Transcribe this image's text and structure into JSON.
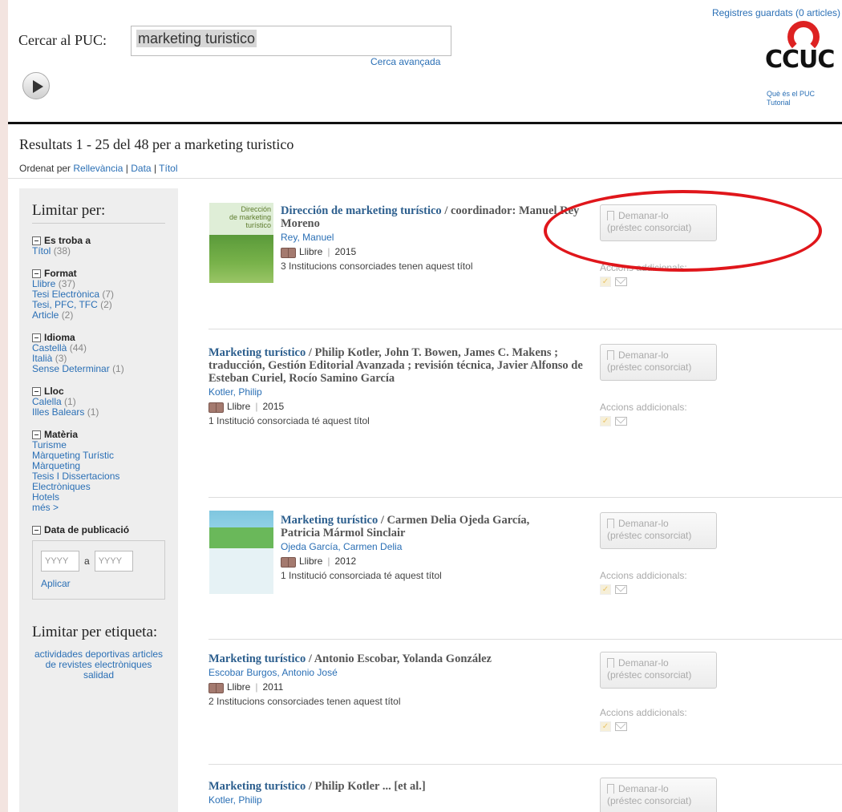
{
  "header": {
    "saved_records": "Registres guardats (0 articles)",
    "search_label": "Cercar al PUC:",
    "search_value": "marketing turistico",
    "advanced_search": "Cerca avançada",
    "logo_text": "CCUC",
    "logo_link_1": "Què és el PUC",
    "logo_link_2": "Tutorial"
  },
  "results": {
    "summary": "Resultats 1 - 25 del 48 per a marketing turistico",
    "sort_label": "Ordenat per",
    "sort_options": [
      "Rellevància",
      "Data",
      "Títol"
    ]
  },
  "sidebar": {
    "title": "Limitar per:",
    "facets": [
      {
        "name": "Es troba a",
        "items": [
          {
            "label": "Títol",
            "count": "(38)"
          }
        ]
      },
      {
        "name": "Format",
        "items": [
          {
            "label": "Llibre",
            "count": "(37)"
          },
          {
            "label": "Tesi Electrònica",
            "count": "(7)"
          },
          {
            "label": "Tesi, PFC, TFC",
            "count": "(2)"
          },
          {
            "label": "Article",
            "count": "(2)"
          }
        ]
      },
      {
        "name": "Idioma",
        "items": [
          {
            "label": "Castellà",
            "count": "(44)"
          },
          {
            "label": "Italià",
            "count": "(3)"
          },
          {
            "label": "Sense Determinar",
            "count": "(1)"
          }
        ]
      },
      {
        "name": "Lloc",
        "items": [
          {
            "label": "Calella",
            "count": "(1)"
          },
          {
            "label": "Illes Balears",
            "count": "(1)"
          }
        ]
      },
      {
        "name": "Matèria",
        "items": [
          {
            "label": "Turisme",
            "count": ""
          },
          {
            "label": "Màrqueting Turístic",
            "count": ""
          },
          {
            "label": "Màrqueting",
            "count": ""
          },
          {
            "label": "Tesis I Dissertacions Electròniques",
            "count": ""
          },
          {
            "label": "Hotels",
            "count": ""
          },
          {
            "label": "més >",
            "count": ""
          }
        ]
      }
    ],
    "date_facet": "Data de publicació",
    "date_from_placeholder": "YYYY",
    "date_to_placeholder": "YYYY",
    "date_sep": "a",
    "apply": "Aplicar",
    "tags_title": "Limitar per etiqueta:",
    "tags_text": "actividades deportivas articles de revistes electròniques salidad"
  },
  "items": [
    {
      "title": "Dirección de marketing turístico",
      "resp": "/ coordinador: Manuel Rey Moreno",
      "author": "Rey, Manuel",
      "format": "Llibre",
      "year": "2015",
      "institutions": "3 Institucions consorciades tenen aquest títol"
    },
    {
      "title": "Marketing turístico",
      "resp": "/ Philip Kotler, John T. Bowen, James C. Makens ; traducción, Gestión Editorial Avanzada ; revisión técnica, Javier Alfonso de Esteban Curiel, Rocío Samino García",
      "author": "Kotler, Philip",
      "format": "Llibre",
      "year": "2015",
      "institutions": "1 Institució consorciada té aquest títol"
    },
    {
      "title": "Marketing turístico",
      "resp": "/ Carmen Delia Ojeda García, Patricia Mármol Sinclair",
      "author": "Ojeda García, Carmen Delia",
      "format": "Llibre",
      "year": "2012",
      "institutions": "1 Institució consorciada té aquest títol"
    },
    {
      "title": "Marketing turístico",
      "resp": "/ Antonio Escobar, Yolanda González",
      "author": "Escobar Burgos, Antonio José",
      "format": "Llibre",
      "year": "2011",
      "institutions": "2 Institucions consorciades tenen aquest títol"
    },
    {
      "title": "Marketing turístico",
      "resp": "/ Philip Kotler ... [et al.]",
      "author": "Kotler, Philip",
      "format": "",
      "year": "",
      "institutions": ""
    }
  ],
  "actions": {
    "request_line1": "Demanar-lo",
    "request_line2": "(préstec consorciat)",
    "additional": "Accions addicionals:"
  },
  "colors": {
    "link": "#2a6fb5",
    "annotation": "#e0161b",
    "logo_red": "#dd2222"
  }
}
